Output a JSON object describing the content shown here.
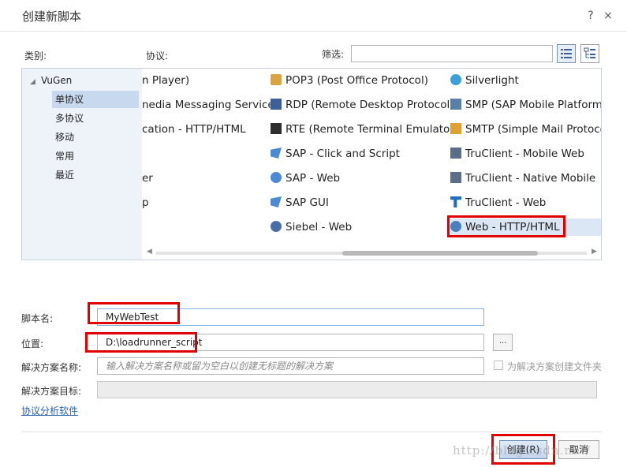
{
  "window": {
    "title": "创建新脚本",
    "help_label": "?",
    "close_label": "×"
  },
  "labels": {
    "category": "类别:",
    "protocol": "协议:",
    "filter": "筛选:"
  },
  "filter": {
    "value": ""
  },
  "tree": {
    "root": "VuGen",
    "items": [
      {
        "label": "单协议",
        "selected": true
      },
      {
        "label": "多协议",
        "selected": false
      },
      {
        "label": "移动",
        "selected": false
      },
      {
        "label": "常用",
        "selected": false
      },
      {
        "label": "最近",
        "selected": false
      }
    ]
  },
  "protocols": {
    "col1": [
      "n Player)",
      "nedia Messaging Service)",
      "cation - HTTP/HTML",
      "",
      "er",
      "p"
    ],
    "col2": [
      {
        "label": "POP3 (Post Office Protocol)",
        "icon": "pop3-icon",
        "color": "#d9a441"
      },
      {
        "label": "RDP (Remote Desktop Protocol)",
        "icon": "rdp-icon",
        "color": "#3a5f9a"
      },
      {
        "label": "RTE (Remote Terminal Emulator)",
        "icon": "rte-icon",
        "color": "#2d2d2d"
      },
      {
        "label": "SAP - Click and Script",
        "icon": "sap-click-icon",
        "color": "#4a8ad6"
      },
      {
        "label": "SAP - Web",
        "icon": "sap-web-icon",
        "color": "#4a8ad6"
      },
      {
        "label": "SAP GUI",
        "icon": "sap-gui-icon",
        "color": "#4a8ad6"
      },
      {
        "label": "Siebel - Web",
        "icon": "siebel-icon",
        "color": "#4a6fa8"
      }
    ],
    "col3": [
      {
        "label": "Silverlight",
        "icon": "silverlight-icon",
        "color": "#3aa0d8",
        "selected": false
      },
      {
        "label": "SMP (SAP Mobile Platform)",
        "icon": "smp-icon",
        "color": "#5a7fa8",
        "selected": false
      },
      {
        "label": "SMTP (Simple Mail Protocol)",
        "icon": "smtp-icon",
        "color": "#e0a030",
        "selected": false
      },
      {
        "label": "TruClient - Mobile Web",
        "icon": "truclient-mobile-icon",
        "color": "#5a6e8a",
        "selected": false
      },
      {
        "label": "TruClient - Native Mobile",
        "icon": "truclient-native-icon",
        "color": "#5a6e8a",
        "selected": false
      },
      {
        "label": "TruClient - Web",
        "icon": "truclient-web-icon",
        "color": "#1f6fbf",
        "selected": false
      },
      {
        "label": "Web - HTTP/HTML",
        "icon": "web-http-icon",
        "color": "#4a7fc0",
        "selected": true
      }
    ]
  },
  "form": {
    "script_name_label": "脚本名:",
    "script_name_value": "MyWebTest",
    "location_label": "位置:",
    "location_value": "D:\\loadrunner_script",
    "browse_label": "...",
    "solution_name_label": "解决方案名称:",
    "solution_name_placeholder": "输入解决方案名称或留为空白以创建无标题的解决方案",
    "solution_folder_checkbox": "为解决方案创建文件夹",
    "solution_target_label": "解决方案目标:",
    "solution_target_value": ""
  },
  "link": {
    "protocol_advisor": "协议分析软件"
  },
  "buttons": {
    "create": "创建(R)",
    "cancel": "取消"
  },
  "watermark": "http://blog.csdn.net/",
  "colors": {
    "highlight": "#e00000",
    "selection": "#c7d8ef",
    "link": "#2a63b8"
  }
}
